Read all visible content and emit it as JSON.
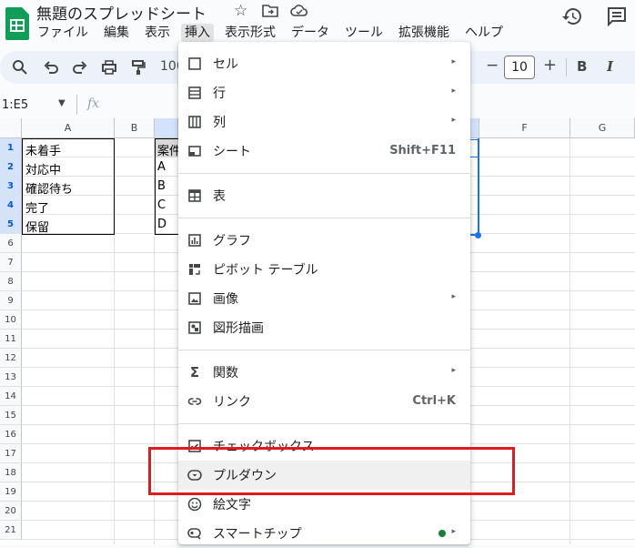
{
  "app": {
    "doc_title": "無題のスプレッドシート",
    "menus": [
      "ファイル",
      "編集",
      "表示",
      "挿入",
      "表示形式",
      "データ",
      "ツール",
      "拡張機能",
      "ヘルプ"
    ],
    "active_menu": "挿入"
  },
  "toolbar": {
    "zoom": "100",
    "font_size": "10",
    "minus": "−",
    "plus": "+",
    "bold": "B",
    "italic": "I"
  },
  "formula_bar": {
    "name_box": "1:E5",
    "fx": "fx"
  },
  "sheet": {
    "columns": [
      "A",
      "B",
      "F",
      "G"
    ],
    "rows": [
      "1",
      "2",
      "3",
      "4",
      "5",
      "6",
      "7",
      "8",
      "9",
      "10",
      "11",
      "12",
      "13",
      "14",
      "15",
      "16",
      "17",
      "18",
      "19",
      "20",
      "21"
    ],
    "col_a_values": [
      "未着手",
      "対応中",
      "確認待ち",
      "完了",
      "保留"
    ],
    "col_c_values": [
      "案件",
      "A",
      "B",
      "C",
      "D"
    ]
  },
  "insert_menu": {
    "items": [
      {
        "label": "セル",
        "icon": "cell-icon",
        "submenu": true
      },
      {
        "label": "行",
        "icon": "row-icon",
        "submenu": true
      },
      {
        "label": "列",
        "icon": "column-icon",
        "submenu": true
      },
      {
        "label": "シート",
        "icon": "sheet-icon",
        "shortcut": "Shift+F11"
      },
      {
        "label": "表",
        "icon": "table-icon"
      },
      {
        "label": "グラフ",
        "icon": "chart-icon"
      },
      {
        "label": "ピボット テーブル",
        "icon": "pivot-table-icon"
      },
      {
        "label": "画像",
        "icon": "image-icon",
        "submenu": true
      },
      {
        "label": "図形描画",
        "icon": "drawing-icon"
      },
      {
        "label": "関数",
        "icon": "sigma-icon",
        "submenu": true
      },
      {
        "label": "リンク",
        "icon": "link-icon",
        "shortcut": "Ctrl+K"
      },
      {
        "label": "チェックボックス",
        "icon": "checkbox-icon"
      },
      {
        "label": "プルダウン",
        "icon": "dropdown-icon"
      },
      {
        "label": "絵文字",
        "icon": "emoji-icon"
      },
      {
        "label": "スマートチップ",
        "icon": "smart-chip-icon",
        "submenu": true
      }
    ],
    "highlighted_item": "プルダウン",
    "arrow_glyph": "▸"
  },
  "colors": {
    "menu_hover": "#f0f0f0",
    "annotation_box": "#e01b1b",
    "selection_blue": "#1a73e8",
    "new_dot": "#188038"
  }
}
